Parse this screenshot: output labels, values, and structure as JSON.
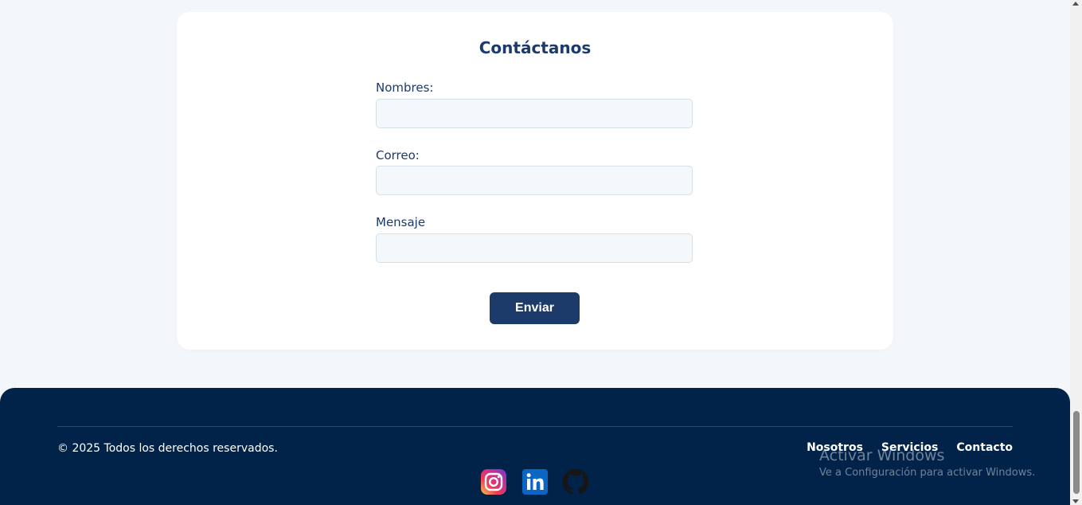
{
  "contact": {
    "title": "Contáctanos",
    "fields": [
      {
        "label": "Nombres:",
        "value": "",
        "placeholder": ""
      },
      {
        "label": "Correo:",
        "value": "",
        "placeholder": ""
      },
      {
        "label": "Mensaje",
        "value": "",
        "placeholder": ""
      }
    ],
    "submit_label": "Enviar"
  },
  "footer": {
    "copyright": "© 2025 Todos los derechos reservados.",
    "links": [
      "Nosotros",
      "Servicios",
      "Contacto"
    ],
    "social_icons": [
      "instagram-icon",
      "linkedin-icon",
      "github-icon"
    ]
  },
  "watermark": {
    "title": "Activar Windows",
    "subtitle": "Ve a Configuración para activar Windows."
  },
  "colors": {
    "page_bg": "#f3f6fa",
    "accent": "#1c3a6a",
    "footer_bg": "#012349",
    "input_bg": "#f5f8fb"
  }
}
